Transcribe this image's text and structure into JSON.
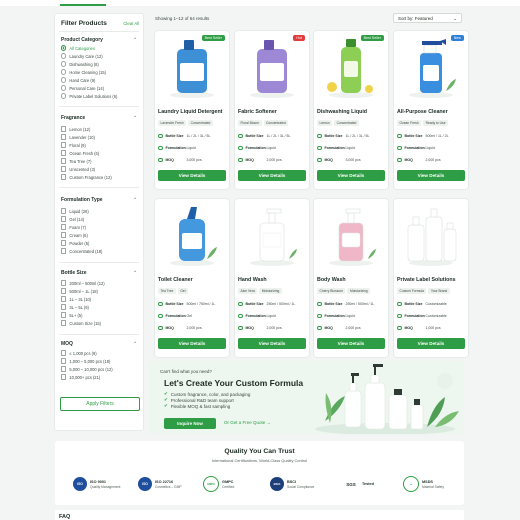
{
  "sidebar": {
    "title": "Filter Products",
    "clear": "Clear All",
    "groups": [
      {
        "title": "Product Category",
        "options": [
          "All Categories",
          "Laundry Care (12)",
          "Dishwashing (8)",
          "Home Cleaning (15)",
          "Hand Care (9)",
          "Personal Care (14)",
          "Private Label Solutions (6)"
        ]
      },
      {
        "title": "Fragrance",
        "options": [
          "Lemon (12)",
          "Lavender (10)",
          "Floral (9)",
          "Ocean Fresh (6)",
          "Tea Tree (7)",
          "Unscented (3)",
          "Custom Fragrance (12)"
        ]
      },
      {
        "title": "Formulation Type",
        "options": [
          "Liquid (28)",
          "Gel (14)",
          "Foam (7)",
          "Cream (6)",
          "Powder (5)",
          "Concentrated (18)"
        ]
      },
      {
        "title": "Bottle Size",
        "options": [
          "200ml – 500ml (12)",
          "500ml – 1L (18)",
          "1L – 3L (10)",
          "3L – 5L (9)",
          "5L+ (5)",
          "Custom Size (15)"
        ]
      },
      {
        "title": "MOQ",
        "options": [
          "≤ 1,000 pcs (9)",
          "1,000 – 5,000 pcs (18)",
          "5,000 – 10,000 pcs (12)",
          "10,000+ pcs (21)"
        ]
      }
    ],
    "apply": "Apply Filters"
  },
  "results": {
    "showing": "Showing 1–12 of 64 results",
    "sort": "Sort by: Featured"
  },
  "spec_labels": {
    "size": "Bottle Size",
    "form": "Formulation",
    "moq": "MOQ"
  },
  "products": [
    {
      "name": "Laundry Liquid Detergent",
      "badge": "Best Seller",
      "tags": [
        "Lavender Fresh",
        "Concentrated"
      ],
      "size": "1L / 2L / 3L / 5L",
      "form": "Liquid",
      "moq": "3,000 pcs"
    },
    {
      "name": "Fabric Softener",
      "badge": "Hot",
      "tags": [
        "Floral Bloom",
        "Concentrated"
      ],
      "size": "1L / 2L / 3L / 5L",
      "form": "Liquid",
      "moq": "2,000 pcs"
    },
    {
      "name": "Dishwashing Liquid",
      "badge": "Best Seller",
      "tags": [
        "Lemon",
        "Concentrated"
      ],
      "size": "1L / 2L / 3L / 5L",
      "form": "Liquid",
      "moq": "3,000 pcs"
    },
    {
      "name": "All-Purpose Cleaner",
      "badge": "New",
      "tags": [
        "Ocean Fresh",
        "Ready to Use"
      ],
      "size": "500ml / 1L / 2L",
      "form": "Liquid",
      "moq": "2,000 pcs"
    },
    {
      "name": "Toilet Cleaner",
      "badge": "",
      "tags": [
        "Tea Tree",
        "Gel"
      ],
      "size": "500ml / 750ml / 1L",
      "form": "Gel",
      "moq": "2,000 pcs"
    },
    {
      "name": "Hand Wash",
      "badge": "",
      "tags": [
        "Aloe Vera",
        "Moisturizing"
      ],
      "size": "250ml / 500ml / 1L",
      "form": "Liquid",
      "moq": "2,000 pcs"
    },
    {
      "name": "Body Wash",
      "badge": "",
      "tags": [
        "Cherry Blossom",
        "Moisturizing"
      ],
      "size": "250ml / 500ml / 1L",
      "form": "Liquid",
      "moq": "2,000 pcs"
    },
    {
      "name": "Private Label Solutions",
      "badge": "",
      "tags": [
        "Custom Formula",
        "Your Brand"
      ],
      "size": "Customizable",
      "form": "Customizable",
      "moq": "1,000 pcs"
    }
  ],
  "view_details": "View Details",
  "banner": {
    "small": "Can't find what you need?",
    "title": "Let's Create Your Custom Formula",
    "bullets": [
      "Custom fragrance, color, and packaging",
      "Professional R&D team support",
      "Flexible MOQ & fast sampling"
    ],
    "inquire": "Inquire Now",
    "quote": "Or Get a Free Quote →"
  },
  "trust": {
    "title": "Quality You Can Trust",
    "subtitle": "International Certifications, World-Class Quality Control",
    "certs": [
      {
        "logo": "ISO",
        "name": "ISO 9001",
        "desc": "Quality Management"
      },
      {
        "logo": "ISO",
        "name": "ISO 22716",
        "desc": "Cosmetics – GMP"
      },
      {
        "logo": "GMPC",
        "name": "GMPC",
        "desc": "Certified"
      },
      {
        "logo": "BSCI",
        "name": "BSCI",
        "desc": "Social Compliance"
      },
      {
        "logo": "SGS",
        "name": "SGS",
        "desc": "Tested"
      },
      {
        "logo": "MSDS",
        "name": "MSDS",
        "desc": "Material Safety"
      }
    ]
  },
  "faq": "FAQ",
  "colors": {
    "accent": "#2e9d45",
    "badge_best": "#2e9d45",
    "badge_hot": "#e23b3b",
    "badge_new": "#2f7fd6"
  }
}
